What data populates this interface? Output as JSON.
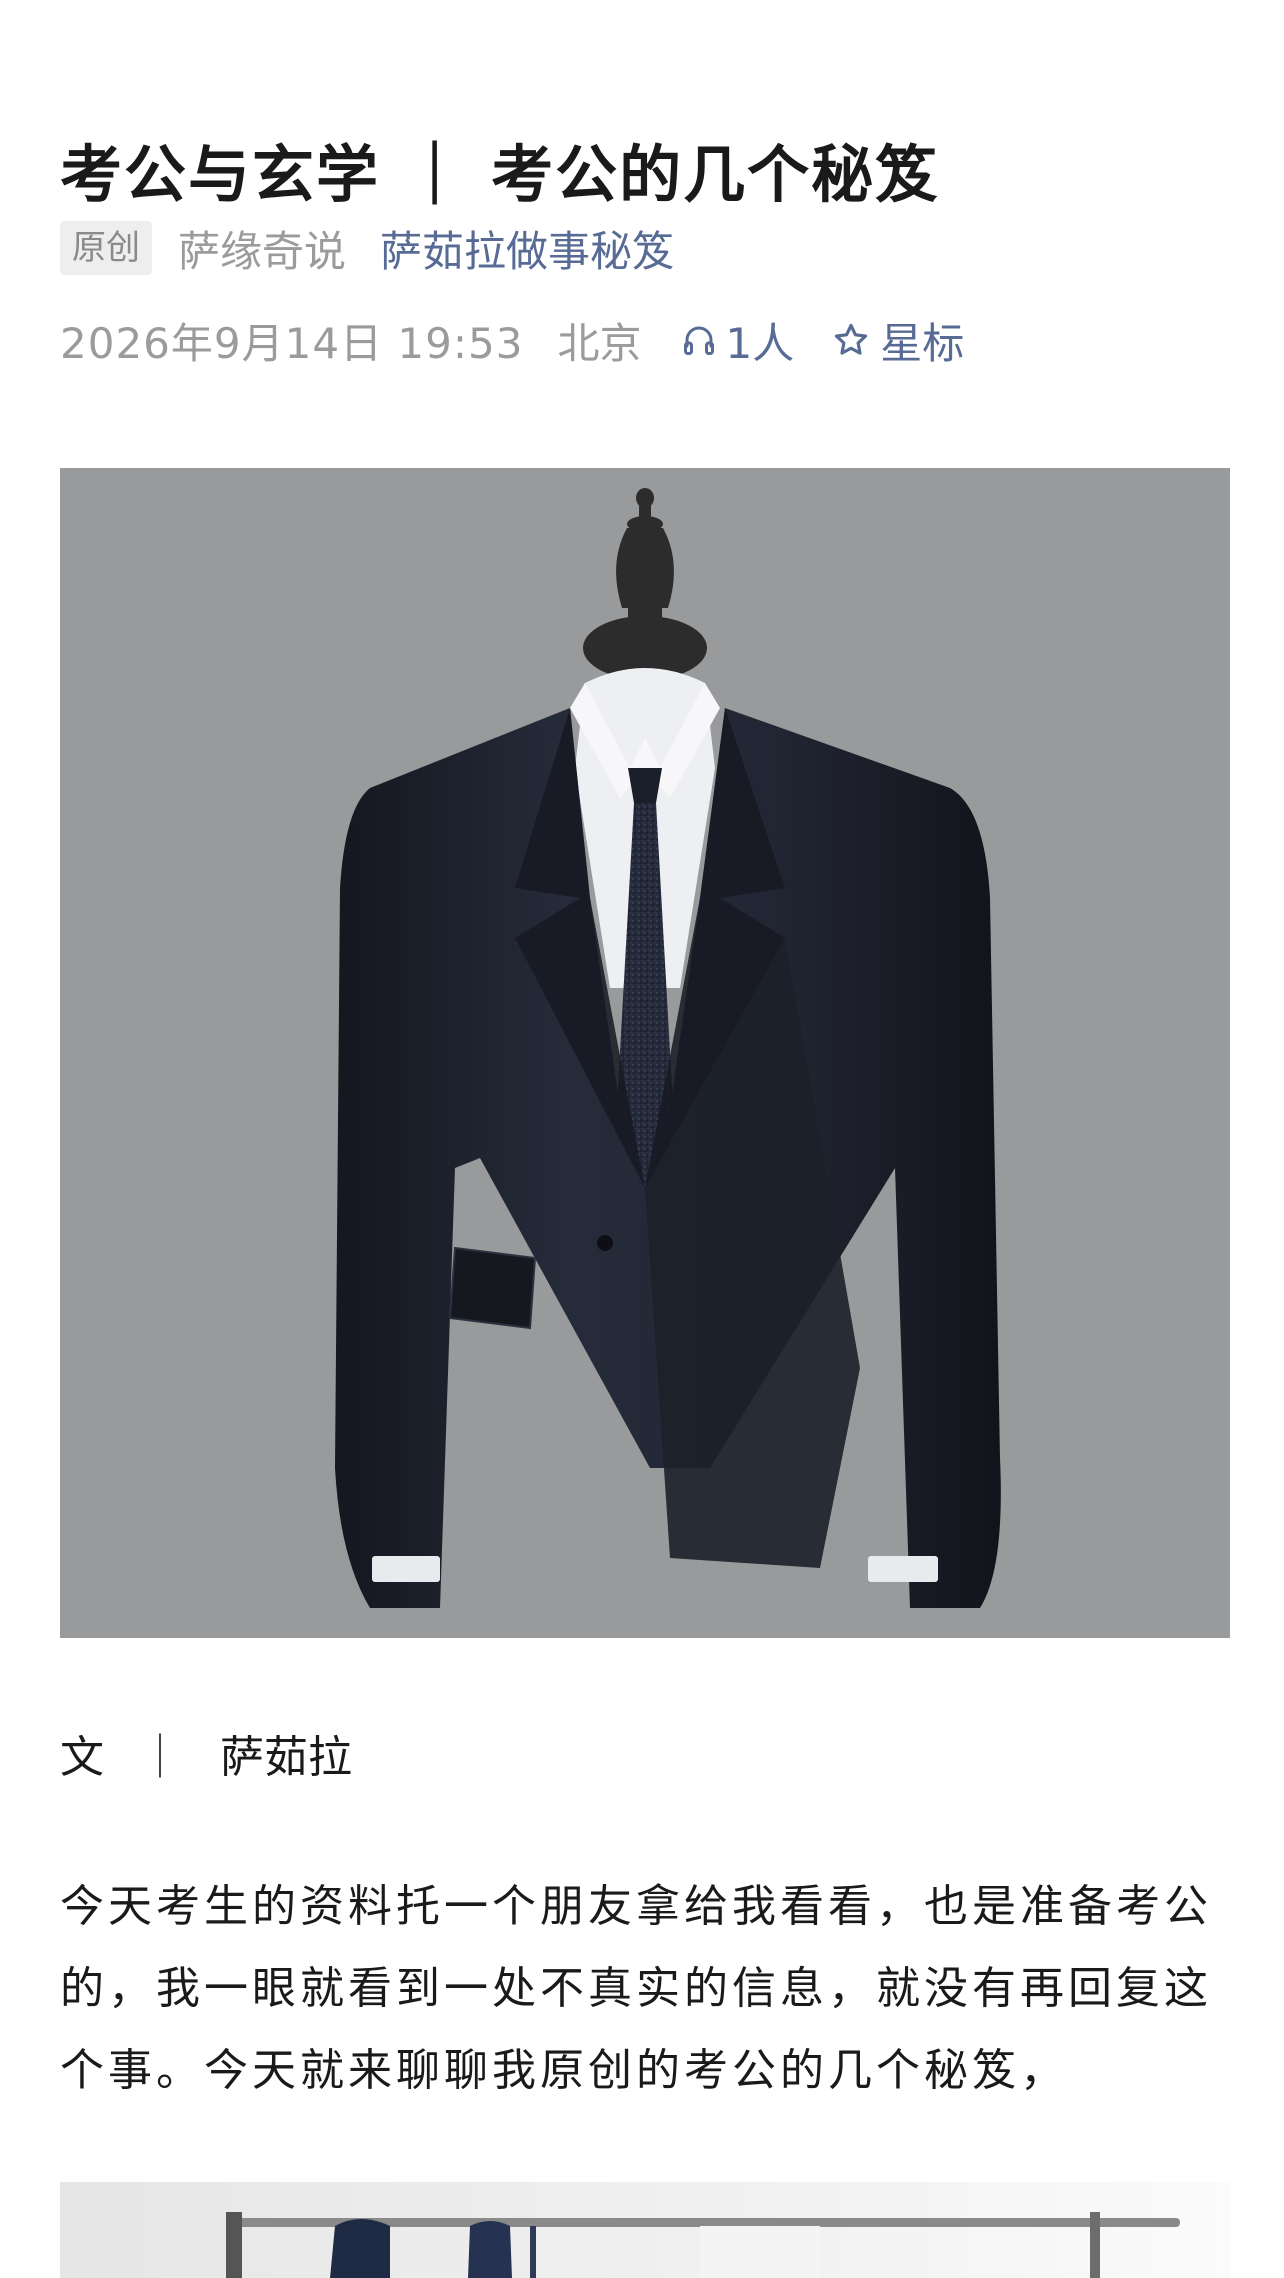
{
  "article": {
    "title": "考公与玄学 ｜ 考公的几个秘笈",
    "badge": "原创",
    "account": "萨缘奇说",
    "collection": "萨茹拉做事秘笈",
    "date": "2026年9月14日 19:53",
    "location": "北京",
    "listen_count": "1人",
    "star_label": "星标"
  },
  "body": {
    "byline_prefix": "文",
    "byline_sep": "｜",
    "author": "萨茹拉",
    "paragraph": "今天考生的资料托一个朋友拿给我看看，也是准备考公的，我一眼就看到一处不真实的信息，就没有再回复这个事。今天就来聊聊我原创的考公的几个秘笈，"
  },
  "icons": {
    "listen": "headphones-icon",
    "star": "star-outline-icon"
  },
  "colors": {
    "link": "#576b95",
    "meta_gray": "#9b9b9b",
    "hero_bg": "#999a9b",
    "suit": "#1e2230"
  }
}
